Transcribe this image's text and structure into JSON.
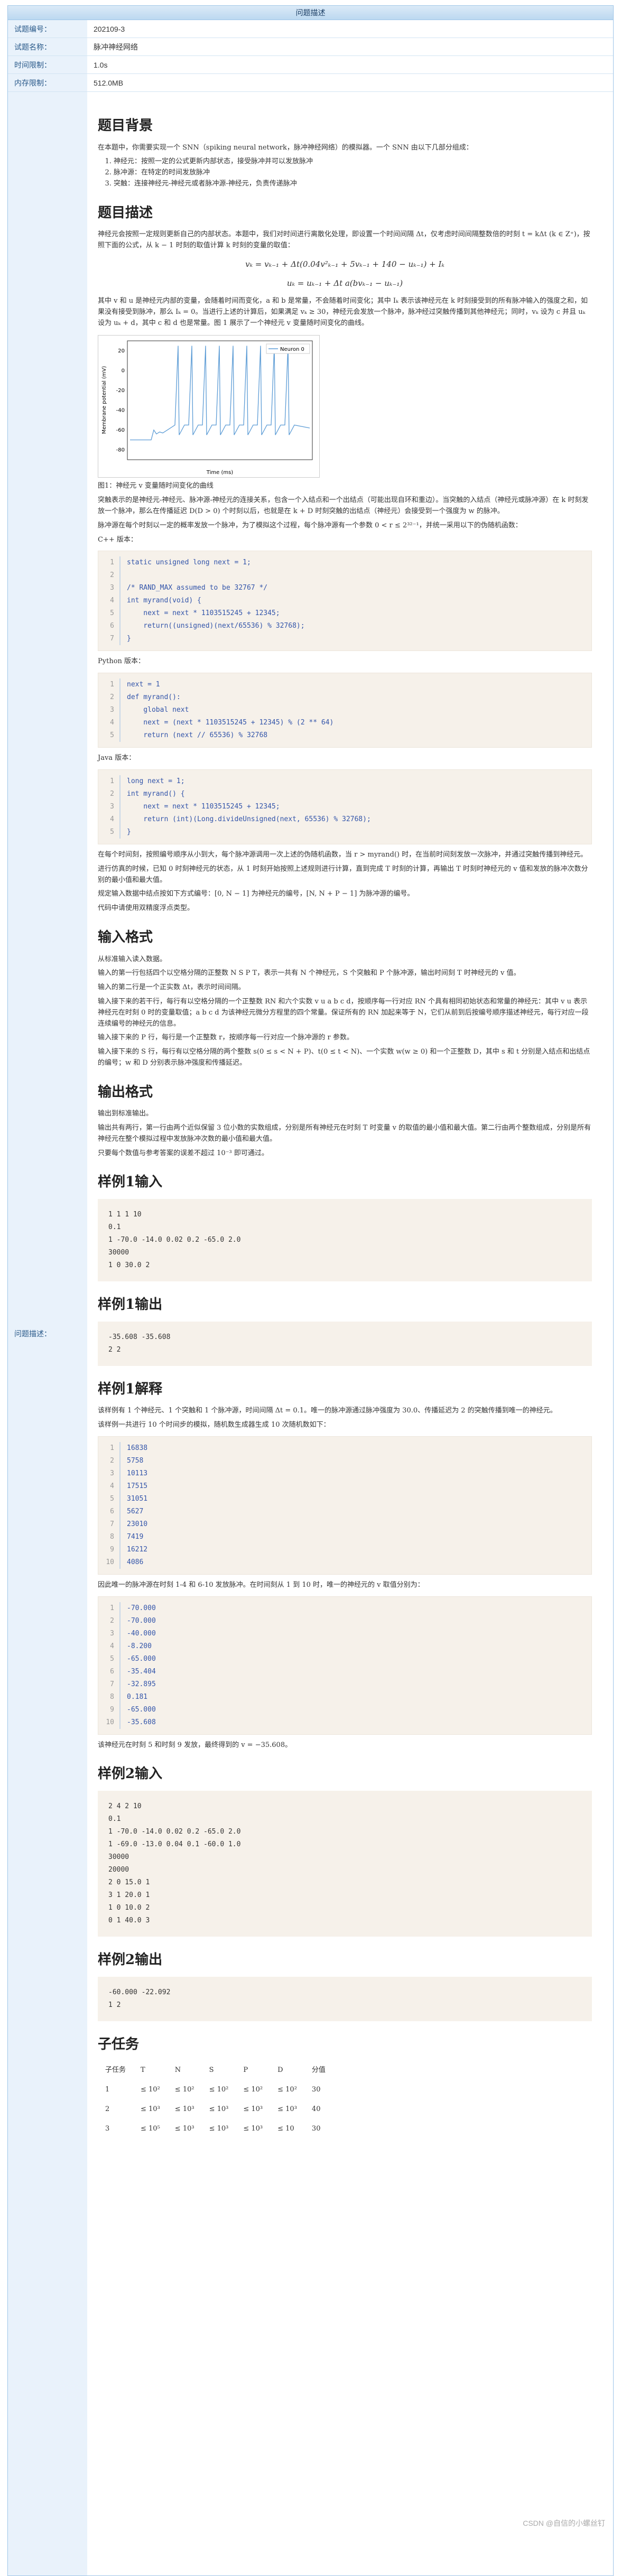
{
  "header": {
    "title": "问题描述"
  },
  "meta": [
    {
      "label": "试题编号：",
      "value": "202109-3"
    },
    {
      "label": "试题名称：",
      "value": "脉冲神经网络"
    },
    {
      "label": "时间限制：",
      "value": "1.0s"
    },
    {
      "label": "内存限制：",
      "value": "512.0MB"
    }
  ],
  "desc_label": "问题描述：",
  "sections": {
    "background_title": "题目背景",
    "background_intro": "在本题中，你需要实现一个 SNN（spiking neural network，脉冲神经网络）的模拟器。一个 SNN 由以下几部分组成：",
    "background_items": [
      "神经元：按照一定的公式更新内部状态，接受脉冲并可以发放脉冲",
      "脉冲源：在特定的时间发放脉冲",
      "突触：连接神经元-神经元或者脉冲源-神经元，负责传递脉冲"
    ],
    "desc_title": "题目描述",
    "desc_p1": "神经元会按照一定规则更新自己的内部状态。本题中，我们对时间进行离散化处理，即设置一个时间间隔 Δt，仅考虑时间间隔整数倍的时刻 t = kΔt (k ∈ Z⁺)，按照下面的公式，从 k − 1 时刻的取值计算 k 时刻的变量的取值：",
    "formula1": "vₖ = vₖ₋₁ + Δt(0.04v²ₖ₋₁ + 5vₖ₋₁ + 140 − uₖ₋₁) + Iₖ",
    "formula2": "uₖ = uₖ₋₁ + Δt a(bvₖ₋₁ − uₖ₋₁)",
    "desc_p2": "其中 v 和 u 是神经元内部的变量，会随着时间而变化，a 和 b 是常量，不会随着时间变化；其中 Iₖ 表示该神经元在 k 时刻接受到的所有脉冲输入的强度之和，如果没有接受到脉冲，那么 Iₖ = 0。当进行上述的计算后，如果满足 vₖ ≥ 30，神经元会发放一个脉冲，脉冲经过突触传播到其他神经元；同时，vₖ 设为 c 并且 uₖ 设为 uₖ + d，其中 c 和 d 也是常量。图 1 展示了一个神经元 v 变量随时间变化的曲线。",
    "caption": "图1：神经元 v 变量随时间变化的曲线",
    "desc_p3": "突触表示的是神经元-神经元、脉冲源-神经元的连接关系，包含一个入结点和一个出结点（可能出现自环和重边）。当突触的入结点（神经元或脉冲源）在 k 时刻发放一个脉冲，那么在传播延迟 D(D > 0) 个时刻以后，也就是在 k + D 时刻突触的出结点（神经元）会接受到一个强度为 w 的脉冲。",
    "desc_p4": "脉冲源在每个时刻以一定的概率发放一个脉冲，为了模拟这个过程，每个脉冲源有一个参数 0 < r ≤ 2³²⁻¹，并统一采用以下的伪随机函数：",
    "cpp_label": "C++ 版本：",
    "cpp_code": [
      "static unsigned long next = 1;",
      "",
      "/* RAND_MAX assumed to be 32767 */",
      "int myrand(void) {",
      "    next = next * 1103515245 + 12345;",
      "    return((unsigned)(next/65536) % 32768);",
      "}"
    ],
    "python_label": "Python 版本：",
    "python_code": [
      "next = 1",
      "def myrand():",
      "    global next",
      "    next = (next * 1103515245 + 12345) % (2 ** 64)",
      "    return (next // 65536) % 32768"
    ],
    "java_label": "Java 版本：",
    "java_code": [
      "long next = 1;",
      "int myrand() {",
      "    next = next * 1103515245 + 12345;",
      "    return (int)(Long.divideUnsigned(next, 65536) % 32768);",
      "}"
    ],
    "desc_p5": "在每个时间刻，按照编号顺序从小到大，每个脉冲源调用一次上述的伪随机函数，当 r > myrand() 时，在当前时间刻发放一次脉冲，并通过突触传播到神经元。",
    "desc_p6": "进行仿真的时候，已知 0 时刻神经元的状态，从 1 时刻开始按照上述规则进行计算，直到完成 T 时刻的计算，再输出 T 时刻时神经元的 v 值和发放的脉冲次数分别的最小值和最大值。",
    "desc_p7": "规定输入数据中结点按如下方式编号：[0, N − 1] 为神经元的编号，[N, N + P − 1] 为脉冲源的编号。",
    "desc_p8": "代码中请使用双精度浮点类型。",
    "input_title": "输入格式",
    "input_ps": [
      "从标准输入读入数据。",
      "输入的第一行包括四个以空格分隔的正整数 N S P T，表示一共有 N 个神经元，S 个突触和 P 个脉冲源，输出时间刻 T 时神经元的 v 值。",
      "输入的第二行是一个正实数 Δt，表示时间间隔。",
      "输入接下来的若干行，每行有以空格分隔的一个正整数 RN 和六个实数 v u a b c d，按顺序每一行对应 RN 个具有相同初始状态和常量的神经元：其中 v u 表示神经元在时刻 0 时的变量取值；a b c d 为该神经元微分方程里的四个常量。保证所有的 RN 加起来等于 N，它们从前到后按编号顺序描述神经元，每行对应一段连续编号的神经元的信息。",
      "输入接下来的 P 行，每行是一个正整数 r，按顺序每一行对应一个脉冲源的 r 参数。",
      "输入接下来的 S 行，每行有以空格分隔的两个整数 s(0 ≤ s < N + P)、t(0 ≤ t < N)、一个实数 w(w ≥ 0) 和一个正整数 D，其中 s 和 t 分别是入结点和出结点的编号；w 和 D 分别表示脉冲强度和传播延迟。"
    ],
    "output_title": "输出格式",
    "output_ps": [
      "输出到标准输出。",
      "输出共有两行，第一行由两个近似保留 3 位小数的实数组成，分别是所有神经元在时刻 T 时变量 v 的取值的最小值和最大值。第二行由两个整数组成，分别是所有神经元在整个模拟过程中发放脉冲次数的最小值和最大值。",
      "只要每个数值与参考答案的误差不超过 10⁻³ 即可通过。"
    ],
    "sample1_in_title": "样例1输入",
    "sample1_in": "1 1 1 10\n0.1\n1 -70.0 -14.0 0.02 0.2 -65.0 2.0\n30000\n1 0 30.0 2",
    "sample1_out_title": "样例1输出",
    "sample1_out": "-35.608 -35.608\n2 2",
    "sample1_exp_title": "样例1解释",
    "sample1_exp_p1": "该样例有 1 个神经元、1 个突触和 1 个脉冲源，时间间隔 Δt = 0.1。唯一的脉冲源通过脉冲强度为 30.0、传播延迟为 2 的突触传播到唯一的神经元。",
    "sample1_exp_p2": "该样例一共进行 10 个时间步的模拟，随机数生成器生成 10 次随机数如下：",
    "random_list": [
      "16838",
      "5758",
      "10113",
      "17515",
      "31051",
      "5627",
      "23010",
      "7419",
      "16212",
      "4086"
    ],
    "sample1_exp_p3": "因此唯一的脉冲源在时刻 1-4 和 6-10 发放脉冲。在时间刻从 1 到 10 时，唯一的神经元的 v 取值分别为：",
    "v_list": [
      "-70.000",
      "-70.000",
      "-40.000",
      "-8.200",
      "-65.000",
      "-35.404",
      "-32.895",
      "0.181",
      "-65.000",
      "-35.608"
    ],
    "sample1_exp_p4": "该神经元在时刻 5 和时刻 9 发放，最终得到的 v = −35.608。",
    "sample2_in_title": "样例2输入",
    "sample2_in": "2 4 2 10\n0.1\n1 -70.0 -14.0 0.02 0.2 -65.0 2.0\n1 -69.0 -13.0 0.04 0.1 -60.0 1.0\n30000\n20000\n2 0 15.0 1\n3 1 20.0 1\n1 0 10.0 2\n0 1 40.0 3",
    "sample2_out_title": "样例2输出",
    "sample2_out": "-60.000 -22.092\n1 2",
    "subtask_title": "子任务",
    "subtask_headers": [
      "子任务",
      "T",
      "N",
      "S",
      "P",
      "D",
      "分值"
    ],
    "subtasks": [
      [
        "1",
        "≤ 10²",
        "≤ 10²",
        "≤ 10²",
        "≤ 10²",
        "≤ 10²",
        "30"
      ],
      [
        "2",
        "≤ 10³",
        "≤ 10³",
        "≤ 10³",
        "≤ 10³",
        "≤ 10³",
        "40"
      ],
      [
        "3",
        "≤ 10⁵",
        "≤ 10³",
        "≤ 10³",
        "≤ 10³",
        "≤ 10",
        "30"
      ]
    ]
  },
  "chart_data": {
    "type": "line",
    "xlabel": "Time (ms)",
    "ylabel": "Membrane potential (mV)",
    "ylim": [
      -90,
      30
    ],
    "yticks": [
      "20",
      "0",
      "-20",
      "-40",
      "-60",
      "-80"
    ],
    "series": [
      {
        "name": "Neuron 0"
      }
    ]
  },
  "watermark": "CSDN @自信的小螺丝钉"
}
